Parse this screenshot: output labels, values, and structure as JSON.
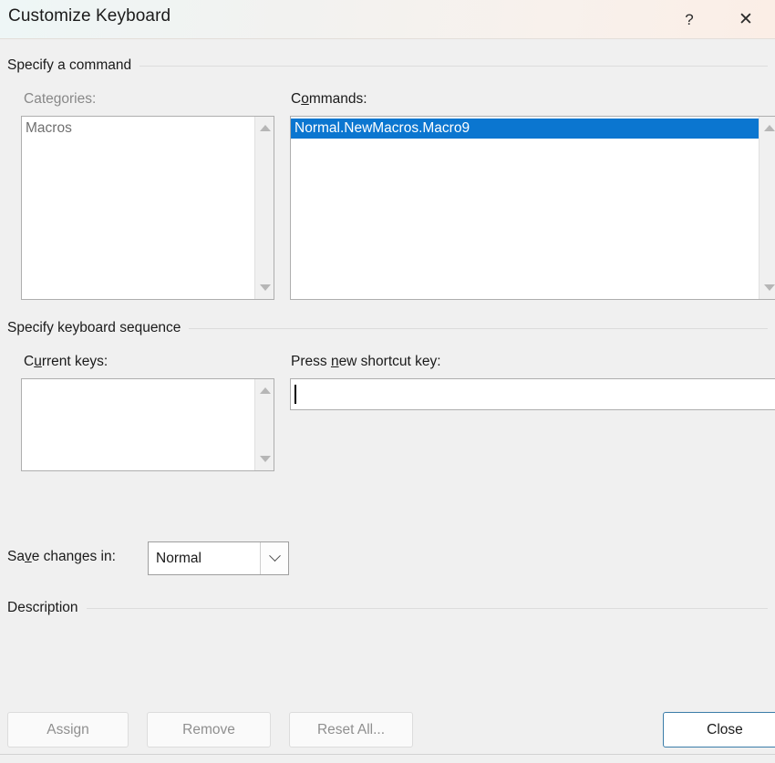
{
  "window": {
    "title": "Customize Keyboard",
    "help_icon": "question-mark-icon",
    "close_icon": "close-icon"
  },
  "groups": {
    "command": {
      "title": "Specify a command"
    },
    "keyboard": {
      "title": "Specify keyboard sequence"
    },
    "description": {
      "title": "Description",
      "body": ""
    }
  },
  "categories": {
    "label": "Categories:",
    "enabled": false,
    "items": [
      "Macros"
    ],
    "selected_index": -1
  },
  "commands": {
    "label_pre": "C",
    "label_accel": "o",
    "label_post": "mmands:",
    "label_full": "Commands:",
    "items": [
      "Normal.NewMacros.Macro9"
    ],
    "selected_index": 0,
    "selection_color": "#0b76d0"
  },
  "current_keys": {
    "label_pre": "C",
    "label_accel": "u",
    "label_post": "rrent keys:",
    "label_full": "Current keys:",
    "items": [],
    "value": ""
  },
  "new_shortcut": {
    "label_pre": "Press ",
    "label_accel": "n",
    "label_post": "ew shortcut key:",
    "label_full": "Press new shortcut key:",
    "value": "",
    "placeholder": "",
    "focused": true
  },
  "save_changes": {
    "label_pre": "Sa",
    "label_accel": "v",
    "label_post": "e changes in:",
    "label_full": "Save changes in:",
    "value": "Normal",
    "options": [
      "Normal"
    ],
    "arrow_icon": "chevron-down-icon"
  },
  "buttons": {
    "assign": {
      "label": "Assign",
      "enabled": false
    },
    "remove": {
      "label": "Remove",
      "enabled": false
    },
    "reset_all": {
      "label": "Reset All...",
      "enabled": false
    },
    "close": {
      "label": "Close",
      "enabled": true,
      "is_default": true,
      "border_color": "#3a7ca8"
    }
  },
  "scroll": {
    "up_icon": "scroll-up-arrow-icon",
    "down_icon": "scroll-down-arrow-icon"
  }
}
